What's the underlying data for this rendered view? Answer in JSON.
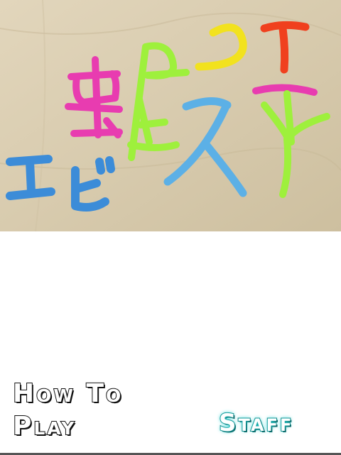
{
  "title_image": {
    "description_icon": "clay-letters-title-logo",
    "clay_colors": {
      "magenta": "#e83cb0",
      "green": "#9ef03c",
      "yellow": "#f2e21e",
      "red": "#f0401e",
      "blue": "#3c8cd8",
      "light_blue": "#5cb0e6"
    },
    "background_color": "#d9ccb0"
  },
  "menu": {
    "how_to_play": "How To Play",
    "staff": "Staff"
  }
}
